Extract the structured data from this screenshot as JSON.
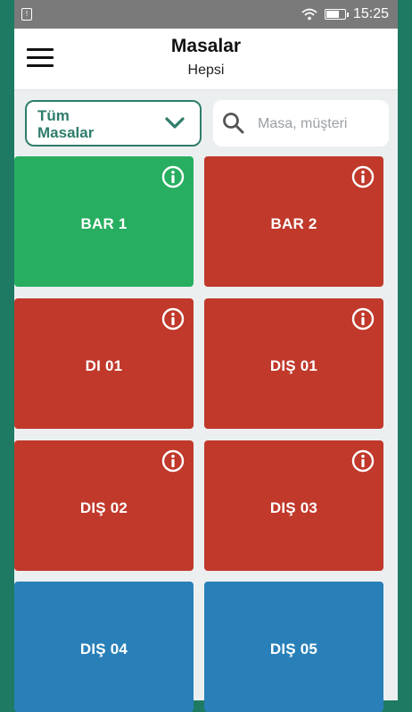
{
  "status_bar": {
    "time": "15:25",
    "sim_glyph": "!"
  },
  "header": {
    "title": "Masalar",
    "subtitle": "Hepsi",
    "menu_icon": "hamburger-menu-icon"
  },
  "filter": {
    "select_label": "Tüm Masalar",
    "search_placeholder": "Masa, müşteri",
    "search_value": ""
  },
  "colors": {
    "green": "#27ae60",
    "red": "#c0392b",
    "blue": "#2980b9",
    "accent": "#2e7d6b"
  },
  "tables": [
    {
      "name": "BAR 1",
      "color": "green",
      "info": true
    },
    {
      "name": "BAR 2",
      "color": "red",
      "info": true
    },
    {
      "name": "DI 01",
      "color": "red",
      "info": true
    },
    {
      "name": "DIŞ 01",
      "color": "red",
      "info": true
    },
    {
      "name": "DIŞ 02",
      "color": "red",
      "info": true
    },
    {
      "name": "DIŞ 03",
      "color": "red",
      "info": true
    },
    {
      "name": "DIŞ 04",
      "color": "blue",
      "info": false
    },
    {
      "name": "DIŞ 05",
      "color": "blue",
      "info": false
    }
  ]
}
